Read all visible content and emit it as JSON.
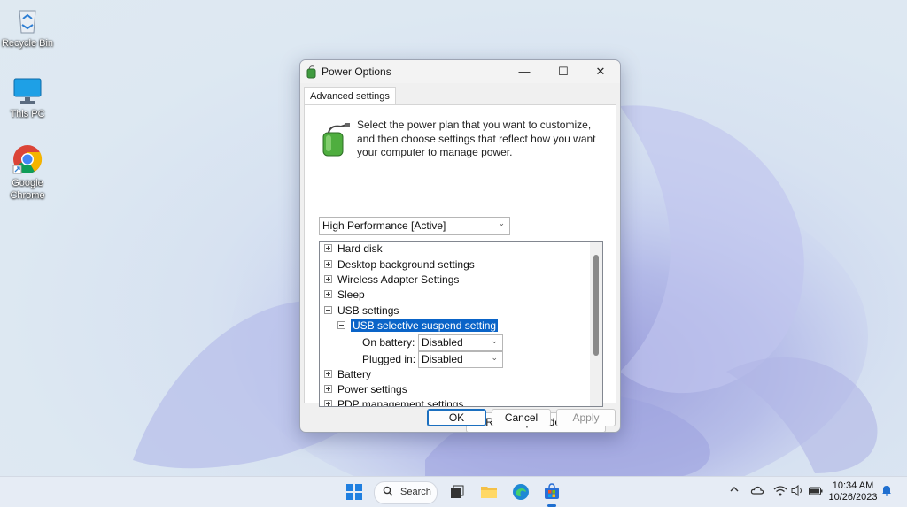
{
  "desktop": {
    "icons": [
      {
        "label": "Recycle Bin"
      },
      {
        "label": "This PC"
      },
      {
        "label": "Google Chrome"
      }
    ]
  },
  "window": {
    "title": "Power Options",
    "tab": "Advanced settings",
    "description": "Select the power plan that you want to customize, and then choose settings that reflect how you want your computer to manage power.",
    "plan_selected": "High Performance [Active]",
    "tree": {
      "items": [
        {
          "label": "Hard disk",
          "expanded": false
        },
        {
          "label": "Desktop background settings",
          "expanded": false
        },
        {
          "label": "Wireless Adapter Settings",
          "expanded": false
        },
        {
          "label": "Sleep",
          "expanded": false
        },
        {
          "label": "USB settings",
          "expanded": true
        },
        {
          "label": "USB selective suspend setting",
          "expanded": true,
          "selected": true
        },
        {
          "label": "Battery",
          "expanded": false
        },
        {
          "label": "Power settings",
          "expanded": false
        },
        {
          "label": "PDP management settings",
          "expanded": false
        }
      ],
      "on_battery_label": "On battery:",
      "on_battery_value": "Disabled",
      "plugged_in_label": "Plugged in:",
      "plugged_in_value": "Disabled"
    },
    "restore_label": "Restore plan defaults",
    "ok_label": "OK",
    "cancel_label": "Cancel",
    "apply_label": "Apply",
    "controls": {
      "minimize": "—",
      "maximize": "☐",
      "close": "✕"
    }
  },
  "taskbar": {
    "search_label": "Search",
    "time": "10:34 AM",
    "date": "10/26/2023",
    "icons": [
      "start-icon",
      "search-icon",
      "task-view-icon",
      "file-explorer-icon",
      "edge-icon",
      "store-icon"
    ]
  },
  "colors": {
    "selection": "#0a64c8",
    "accent": "#1b6fbf"
  }
}
